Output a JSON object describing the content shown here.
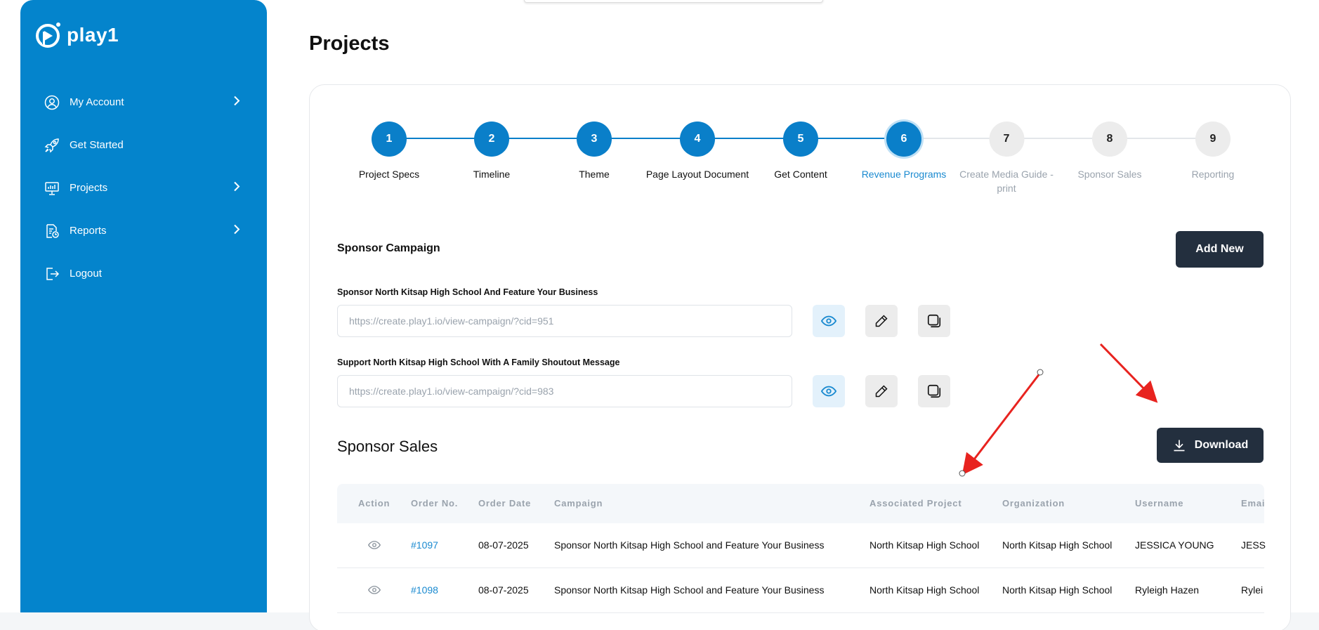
{
  "app": {
    "logo_text": "play1"
  },
  "sidebar": {
    "items": [
      {
        "label": "My Account",
        "icon": "user-circle-icon",
        "has_chevron": true
      },
      {
        "label": "Get Started",
        "icon": "rocket-icon",
        "has_chevron": false
      },
      {
        "label": "Projects",
        "icon": "presentation-icon",
        "has_chevron": true
      },
      {
        "label": "Reports",
        "icon": "report-icon",
        "has_chevron": true
      },
      {
        "label": "Logout",
        "icon": "logout-icon",
        "has_chevron": false
      }
    ]
  },
  "page": {
    "title": "Projects"
  },
  "stepper": {
    "current_step": 6,
    "steps": [
      {
        "number": "1",
        "label": "Project Specs",
        "state": "done"
      },
      {
        "number": "2",
        "label": "Timeline",
        "state": "done"
      },
      {
        "number": "3",
        "label": "Theme",
        "state": "done"
      },
      {
        "number": "4",
        "label": "Page Layout Document",
        "state": "done"
      },
      {
        "number": "5",
        "label": "Get Content",
        "state": "done"
      },
      {
        "number": "6",
        "label": "Revenue Programs",
        "state": "current"
      },
      {
        "number": "7",
        "label": "Create Media Guide - print",
        "state": "todo"
      },
      {
        "number": "8",
        "label": "Sponsor Sales",
        "state": "todo"
      },
      {
        "number": "9",
        "label": "Reporting",
        "state": "todo"
      }
    ]
  },
  "sponsor_campaign": {
    "title": "Sponsor Campaign",
    "add_button": "Add New",
    "campaigns": [
      {
        "label": "Sponsor North Kitsap High School And Feature Your Business",
        "url": "https://create.play1.io/view-campaign/?cid=951"
      },
      {
        "label": "Support North Kitsap High School With A Family Shoutout Message",
        "url": "https://create.play1.io/view-campaign/?cid=983"
      }
    ]
  },
  "sponsor_sales": {
    "title": "Sponsor Sales",
    "download_button": "Download",
    "columns": [
      "Action",
      "Order No.",
      "Order Date",
      "Campaign",
      "Associated Project",
      "Organization",
      "Username",
      "Emai"
    ],
    "rows": [
      {
        "order_no": "#1097",
        "order_date": "08-07-2025",
        "campaign": "Sponsor North Kitsap High School and Feature Your Business",
        "project": "North Kitsap High School",
        "organization": "North Kitsap High School",
        "username": "JESSICA YOUNG",
        "email": "JESS"
      },
      {
        "order_no": "#1098",
        "order_date": "08-07-2025",
        "campaign": "Sponsor North Kitsap High School and Feature Your Business",
        "project": "North Kitsap High School",
        "organization": "North Kitsap High School",
        "username": "Ryleigh Hazen",
        "email": "Rylei"
      }
    ]
  },
  "colors": {
    "sidebar_bg": "#0484cc",
    "accent": "#0a7fc9",
    "dark_button": "#232f3e",
    "annotation_arrow": "#e8231f"
  }
}
